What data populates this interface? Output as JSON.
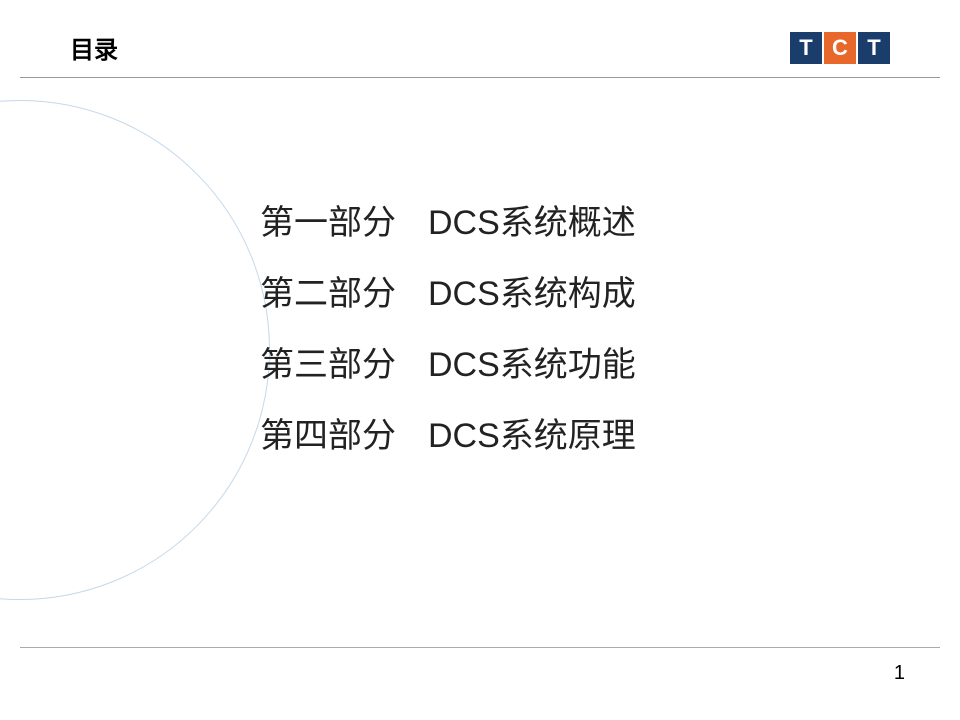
{
  "header": {
    "title": "目录",
    "logo": {
      "letters": [
        "T",
        "C",
        "T"
      ]
    }
  },
  "toc": [
    {
      "part": "第一部分",
      "desc_prefix": "DCS",
      "desc_suffix": "系统概述"
    },
    {
      "part": "第二部分",
      "desc_prefix": "DCS",
      "desc_suffix": "系统构成"
    },
    {
      "part": "第三部分",
      "desc_prefix": "DCS",
      "desc_suffix": "系统功能"
    },
    {
      "part": "第四部分",
      "desc_prefix": "DCS",
      "desc_suffix": "系统原理"
    }
  ],
  "page_number": "1"
}
